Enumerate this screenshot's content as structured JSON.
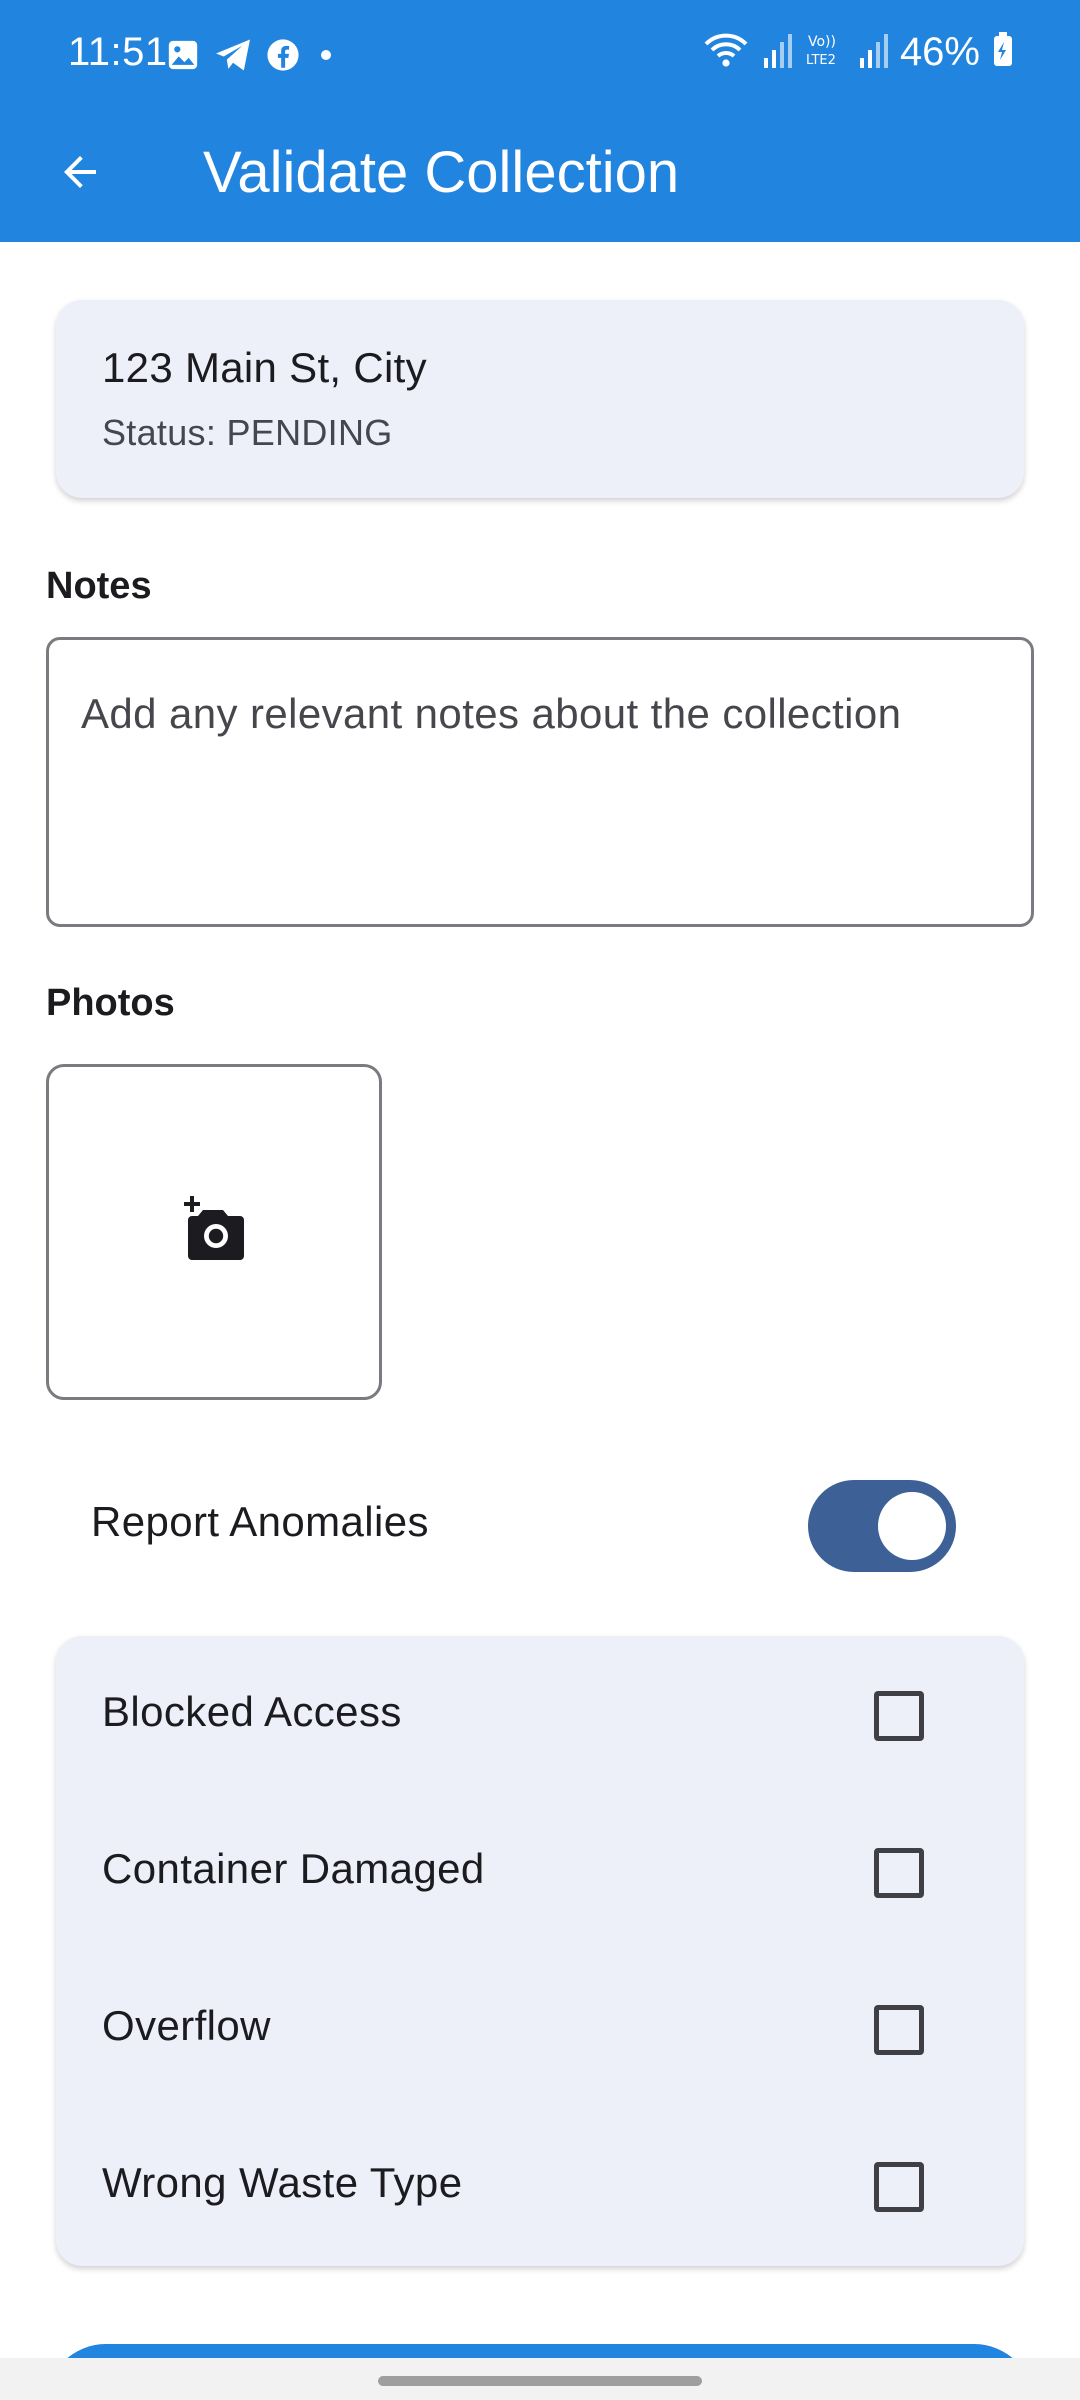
{
  "status_bar": {
    "time": "11:51",
    "battery": "46%",
    "left_icons": [
      "gallery-icon",
      "telegram-icon",
      "facebook-icon",
      "dot-icon"
    ],
    "right_icons": [
      "wifi-icon",
      "signal-icon",
      "volte-icon",
      "signal-icon",
      "battery-icon"
    ],
    "volte_label": "Vo)) LTE2"
  },
  "app_bar": {
    "title": "Validate Collection",
    "back_icon": "arrow-left-icon"
  },
  "address_card": {
    "address": "123 Main St, City",
    "status": "Status: PENDING"
  },
  "notes": {
    "label": "Notes",
    "placeholder": "Add any relevant notes about the collection",
    "value": ""
  },
  "photos": {
    "label": "Photos",
    "add_icon": "add-photo-icon"
  },
  "anomalies": {
    "label": "Report Anomalies",
    "enabled": true,
    "items": [
      {
        "label": "Blocked Access",
        "checked": false
      },
      {
        "label": "Container Damaged",
        "checked": false
      },
      {
        "label": "Overflow",
        "checked": false
      },
      {
        "label": "Wrong Waste Type",
        "checked": false
      }
    ]
  },
  "colors": {
    "primary": "#2184de",
    "toggle_track": "#3d6196",
    "card_bg": "#eef0f9"
  }
}
